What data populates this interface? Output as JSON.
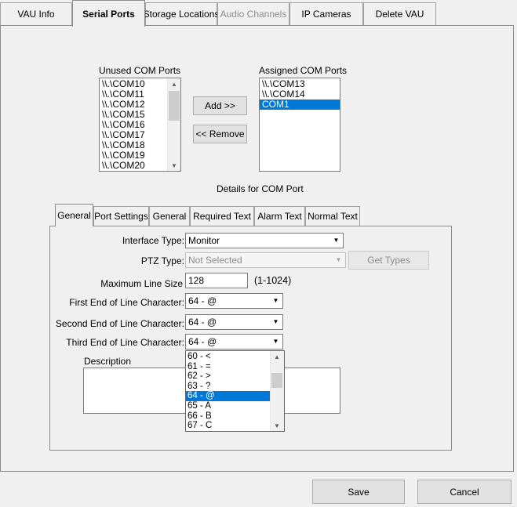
{
  "tabs": [
    {
      "label": "VAU Info",
      "state": "normal"
    },
    {
      "label": "Serial Ports",
      "state": "active"
    },
    {
      "label": "Storage Locations",
      "state": "normal"
    },
    {
      "label": "Audio Channels",
      "state": "disabled"
    },
    {
      "label": "IP Cameras",
      "state": "normal"
    },
    {
      "label": "Delete VAU",
      "state": "normal"
    }
  ],
  "unused_ports": {
    "label": "Unused COM Ports",
    "items": [
      "\\\\.\\COM10",
      "\\\\.\\COM11",
      "\\\\.\\COM12",
      "\\\\.\\COM15",
      "\\\\.\\COM16",
      "\\\\.\\COM17",
      "\\\\.\\COM18",
      "\\\\.\\COM19",
      "\\\\.\\COM20"
    ]
  },
  "assigned_ports": {
    "label": "Assigned COM Ports",
    "items": [
      "\\\\.\\COM13",
      "\\\\.\\COM14",
      "COM1"
    ],
    "selected": "COM1"
  },
  "buttons": {
    "add": "Add >>",
    "remove": "<< Remove",
    "get_types": "Get Types",
    "save": "Save",
    "cancel": "Cancel"
  },
  "details_title": "Details for COM Port",
  "inner_tabs": [
    {
      "label": "General",
      "state": "active"
    },
    {
      "label": "Port Settings",
      "state": "normal"
    },
    {
      "label": "General",
      "state": "normal"
    },
    {
      "label": "Required Text",
      "state": "normal"
    },
    {
      "label": "Alarm Text",
      "state": "normal"
    },
    {
      "label": "Normal Text",
      "state": "normal"
    }
  ],
  "form": {
    "interface_type_label": "Interface Type:",
    "interface_type_value": "Monitor",
    "ptz_type_label": "PTZ Type:",
    "ptz_type_value": "Not Selected",
    "max_line_size_label": "Maximum Line Size",
    "max_line_size_value": "128",
    "max_line_size_range": "(1-1024)",
    "first_eol_label": "First End of Line Character:",
    "first_eol_value": "64 - @",
    "second_eol_label": "Second End of Line Character:",
    "second_eol_value": "64 - @",
    "third_eol_label": "Third End of Line Character:",
    "third_eol_value": "64 - @",
    "description_label": "Description",
    "description_value": ""
  },
  "eol_dropdown": {
    "options": [
      "60 - <",
      "61 - =",
      "62 - >",
      "63 - ?",
      "64 - @",
      "65 - A",
      "66 - B",
      "67 - C"
    ],
    "selected": "64 - @"
  },
  "colors": {
    "selection": "#0078d7",
    "background": "#f0f0f0"
  }
}
